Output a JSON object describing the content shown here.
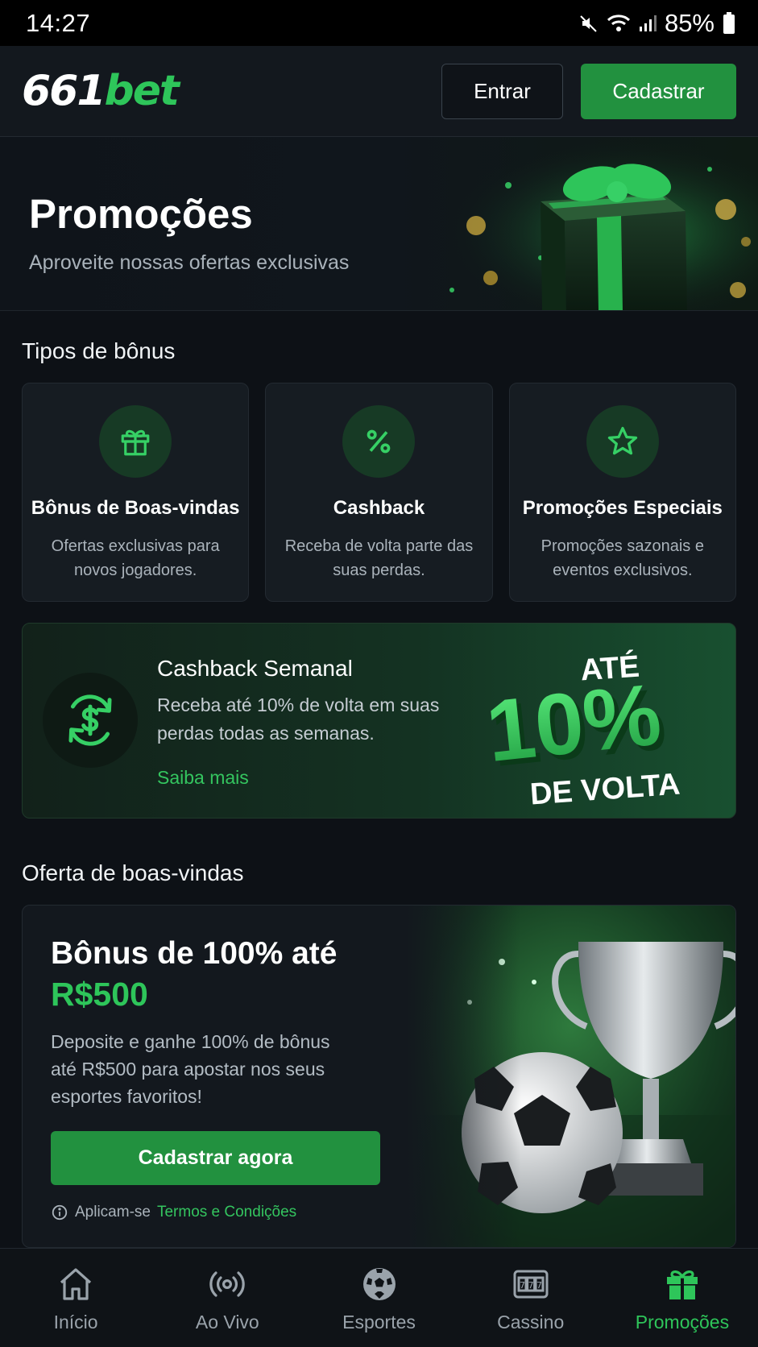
{
  "status_bar": {
    "time": "14:27",
    "battery": "85%"
  },
  "header": {
    "logo_num": "661",
    "logo_txt": "bet",
    "login_label": "Entrar",
    "register_label": "Cadastrar"
  },
  "hero": {
    "title": "Promoções",
    "subtitle": "Aproveite nossas ofertas exclusivas"
  },
  "bonus_types": {
    "title": "Tipos de bônus",
    "items": [
      {
        "icon": "gift-icon",
        "title": "Bônus de Boas-vindas",
        "desc": "Ofertas exclusivas para novos jogadores."
      },
      {
        "icon": "percent-icon",
        "title": "Cashback",
        "desc": "Receba de volta parte das suas perdas."
      },
      {
        "icon": "star-icon",
        "title": "Promoções Especiais",
        "desc": "Promoções sazonais e eventos exclusivos."
      }
    ]
  },
  "cashback": {
    "title": "Cashback Semanal",
    "desc": "Receba até 10% de volta em suas perdas todas as semanas.",
    "link": "Saiba mais",
    "art_top": "ATÉ",
    "art_big": "10%",
    "art_bottom": "DE VOLTA"
  },
  "welcome": {
    "section_title": "Oferta de boas-vindas",
    "headline": "Bônus de 100% até",
    "amount": "R$500",
    "desc": "Deposite e ganhe 100% de bônus até R$500 para apostar nos seus esportes favoritos!",
    "cta": "Cadastrar agora",
    "terms_prefix": "Aplicam-se",
    "terms_link": "Termos e Condições"
  },
  "bottom_nav": [
    {
      "icon": "home-icon",
      "label": "Início"
    },
    {
      "icon": "live-icon",
      "label": "Ao Vivo"
    },
    {
      "icon": "soccer-ball-icon",
      "label": "Esportes"
    },
    {
      "icon": "slot-machine-icon",
      "label": "Cassino"
    },
    {
      "icon": "gift-icon",
      "label": "Promoções",
      "active": true
    }
  ],
  "colors": {
    "accent": "#2ec55a",
    "button_green": "#22913f",
    "background": "#0d1116"
  }
}
